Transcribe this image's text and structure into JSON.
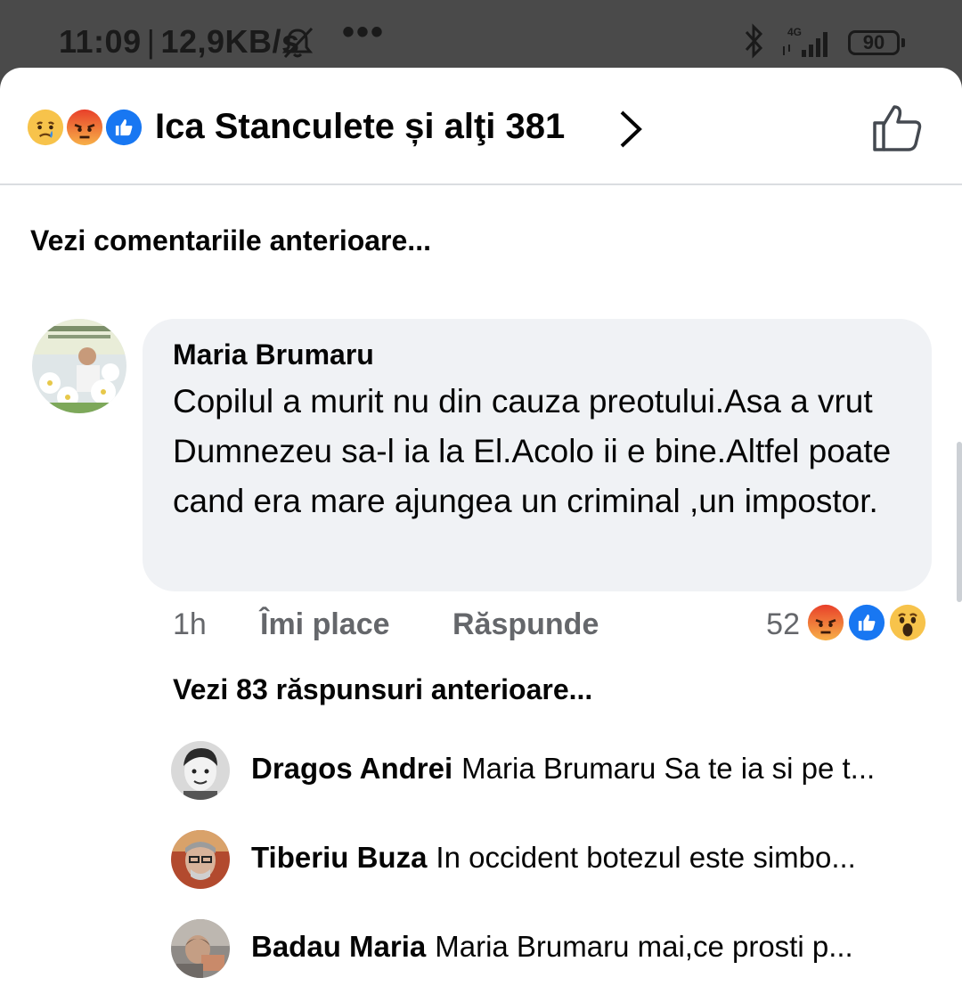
{
  "status_bar": {
    "time": "11:09",
    "net_speed": "12,9KB/s",
    "overflow": "•••",
    "network_type": "4G",
    "battery": "90"
  },
  "header": {
    "title": "Ica Stanculete și alţi 381",
    "reaction_icons": [
      "sad-icon",
      "angry-icon",
      "like-icon"
    ]
  },
  "comments": {
    "see_previous": "Vezi comentariile anterioare...",
    "main": {
      "author": "Maria Brumaru",
      "text": "Copilul a murit nu din cauza preotului.Asa a vrut Dumnezeu sa-l ia la El.Acolo ii e bine.Altfel poate cand era mare ajungea un criminal ,un impostor.",
      "time": "1h",
      "like_label": "Îmi place",
      "reply_label": "Răspunde",
      "reaction_count": "52",
      "reaction_icons": [
        "angry-icon",
        "like-icon",
        "wow-icon"
      ]
    },
    "see_previous_replies": "Vezi 83 răspunsuri anterioare...",
    "replies": [
      {
        "author": "Dragos Andrei",
        "text": "Maria Brumaru Sa te ia si pe t..."
      },
      {
        "author": "Tiberiu Buza",
        "text": "In occident botezul este simbo..."
      },
      {
        "author": "Badau Maria",
        "text": "Maria Brumaru mai,ce prosti p..."
      }
    ]
  },
  "colors": {
    "accent": "#1877f2",
    "bubble": "#f0f2f5",
    "secondary_text": "#65676b",
    "angry": "#f26a2a",
    "sad_wow": "#f7c34b"
  }
}
